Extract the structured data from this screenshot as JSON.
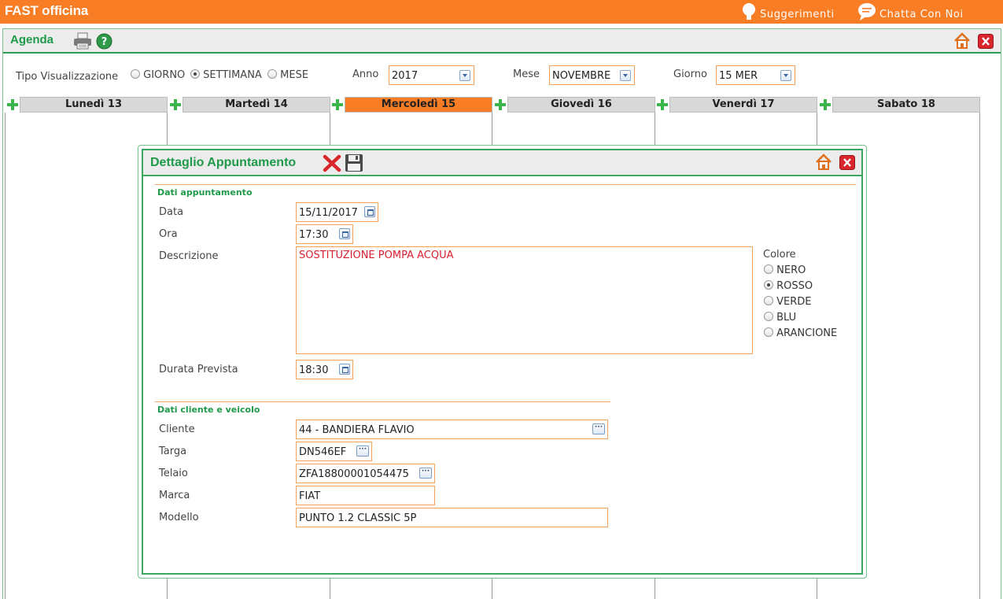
{
  "app": {
    "title": "FAST officina"
  },
  "topbar": {
    "suggestions_label": "Suggerimenti",
    "chat_label": "Chatta Con Noi"
  },
  "agenda": {
    "title": "Agenda",
    "view_type_label": "Tipo Visualizzazione",
    "view_options": [
      "GIORNO",
      "SETTIMANA",
      "MESE"
    ],
    "view_selected": "SETTIMANA",
    "year_label": "Anno",
    "year_value": "2017",
    "month_label": "Mese",
    "month_value": "NOVEMBRE",
    "day_label": "Giorno",
    "day_value": "15 MER",
    "days": [
      "Lunedì 13",
      "Martedì 14",
      "Mercoledì 15",
      "Giovedì 16",
      "Venerdì 17",
      "Sabato 18"
    ],
    "today_index": 2
  },
  "modal": {
    "title": "Dettaglio Appuntamento",
    "section_appointment": "Dati appuntamento",
    "data_label": "Data",
    "data_value": "15/11/2017",
    "ora_label": "Ora",
    "ora_value": "17:30",
    "descrizione_label": "Descrizione",
    "descrizione_value": "SOSTITUZIONE POMPA ACQUA",
    "durata_label": "Durata Prevista",
    "durata_value": "18:30",
    "colore_label": "Colore",
    "colors": [
      "NERO",
      "ROSSO",
      "VERDE",
      "BLU",
      "ARANCIONE"
    ],
    "color_selected": "ROSSO",
    "section_client": "Dati cliente e veicolo",
    "cliente_label": "Cliente",
    "cliente_value": "44 - BANDIERA FLAVIO",
    "targa_label": "Targa",
    "targa_value": "DN546EF",
    "telaio_label": "Telaio",
    "telaio_value": "ZFA18800001054475",
    "marca_label": "Marca",
    "marca_value": "FIAT",
    "modello_label": "Modello",
    "modello_value": "PUNTO 1.2 CLASSIC 5P"
  },
  "colors": {
    "brand": "#f97d24",
    "accent_green": "#1f9a4a",
    "field_border": "#f5a15a",
    "description_text": "#d8202f"
  }
}
